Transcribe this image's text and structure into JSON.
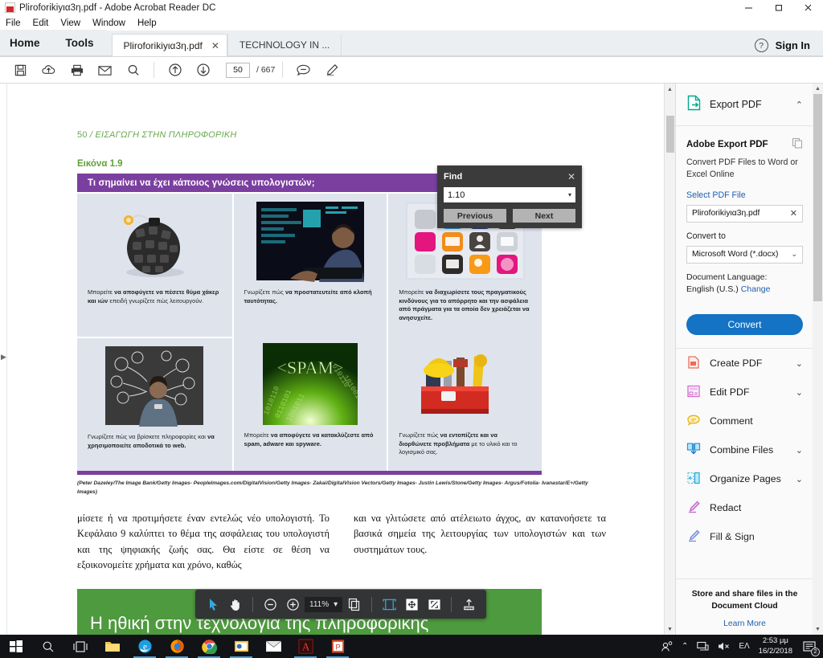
{
  "window": {
    "title": "Pliroforikiyια3η.pdf - Adobe Acrobat Reader DC",
    "minimize": "–",
    "maximize": "❐",
    "close": "✕"
  },
  "menu": [
    "File",
    "Edit",
    "View",
    "Window",
    "Help"
  ],
  "tabs": {
    "home": "Home",
    "tools": "Tools",
    "documents": [
      {
        "label": "Pliroforikiyια3η.pdf",
        "close": "✕",
        "active": true
      },
      {
        "label": "TECHNOLOGY IN ...",
        "active": false
      }
    ],
    "help_icon": "?",
    "sign_in": "Sign In"
  },
  "toolbar": {
    "icons": [
      "save-icon",
      "upload-cloud-icon",
      "print-icon",
      "email-icon",
      "search-icon",
      "previous-page-icon",
      "next-page-icon"
    ],
    "page_number": "50",
    "page_total": "/ 667",
    "comment_icon": "comment-icon",
    "highlight_icon": "highlight-icon"
  },
  "find": {
    "title": "Find",
    "close": "✕",
    "query": "1.10",
    "dropdown_caret": "▾",
    "previous": "Previous",
    "next": "Next"
  },
  "document": {
    "breadcrumb_page": "50",
    "breadcrumb_sep": "/",
    "breadcrumb_title": "ΕΙΣΑΓΩΓΗ ΣΤΗΝ ΠΛΗΡΟΦΟΡΙΚΗ",
    "figure_label": "Εικόνα 1.9",
    "banner": "Τι σημαίνει να έχει κάποιος γνώσεις υπολογιστών;",
    "cells": [
      {
        "image": "keyboard-key-bomb-photo",
        "caption_pre": "Μπορείτε ",
        "caption_bold": "να αποφύγετε να πέσετε θύμα χάκερ και ιών",
        "caption_post": " επειδή γνωρίζετε πώς λειτουργούν."
      },
      {
        "image": "hacker-at-screen-photo",
        "caption_pre": "Γνωρίζετε πώς ",
        "caption_bold": "να προστατευτείτε από κλοπή ταυτότητας.",
        "caption_post": ""
      },
      {
        "image": "security-app-icons-grid",
        "caption_pre": "Μπορείτε ",
        "caption_bold": "να διαχωρίσετε τους πραγματικούς κινδύνους για το απόρρητο και την ασφάλεια από πράγματα για τα οποία δεν χρειάζεται να ανησυχείτε.",
        "caption_post": ""
      },
      {
        "image": "woman-with-phone-chalkboard-photo",
        "caption_pre": "Γνωρίζετε πώς να βρίσκετε πληροφορίες και ",
        "caption_bold": "να χρησιμοποιείτε αποδοτικά το web.",
        "caption_post": ""
      },
      {
        "image": "spam-green-binary-photo",
        "caption_pre": "Μπορείτε ",
        "caption_bold": "να αποφύγετε να κατακλύζεστε από spam, adware και spyware.",
        "caption_post": ""
      },
      {
        "image": "red-toolbox-photo",
        "caption_pre": "Γνωρίζετε πώς ",
        "caption_bold": "να εντοπίζετε και να διορθώνετε προβλήματα",
        "caption_post": " με το υλικό και το λογισμικό σας."
      }
    ],
    "credit": "(Peter Dazeley/The Image Bank/Getty Images- PeopleImages.com/DigitalVision/Getty Images- Zakai/DigitalVision Vectors/Getty Images- Justin Lewis/Stone/Getty Images- Argus/Fotolia- Ivanastar/E+/Getty Images)",
    "body_left": "μίσετε ή να προτιμήσετε έναν εντελώς νέο υπολογιστή. Το Κεφάλαιο 9 καλύπτει το θέμα της ασφάλειας του υπολογιστή και της ψηφιακής ζωής σας. Θα είστε σε θέση να εξοικονομείτε χρήματα και χρόνο, καθώς",
    "body_right": "και να γλιτώσετε από ατέλειωτο άγχος, αν κατανοήσετε τα βασικά σημεία της λειτουργίας των υπολογιστών και των συστημάτων τους.",
    "section_heading": "Η ηθική στην τεχνολογία της πληροφορικής"
  },
  "page_toolbar": {
    "select_icon": "cursor-select-icon",
    "hand_icon": "hand-pan-icon",
    "zoom_out": "−",
    "zoom_in": "+",
    "zoom_level": "111%",
    "zoom_caret": "▾",
    "page_view_icon": "page-view-icon",
    "fit_width_icon": "fit-width-icon",
    "fit_page_icon": "fit-page-icon",
    "full_screen_icon": "full-screen-icon",
    "share_icon": "share-upload-icon"
  },
  "right_panel": {
    "header": {
      "title": "Export PDF",
      "icon": "export-pdf-icon",
      "chevron": "⌃"
    },
    "card": {
      "title": "Adobe Export PDF",
      "copy_icon": "copy-icon",
      "subtitle": "Convert PDF Files to Word or Excel Online",
      "select_file_link": "Select PDF File",
      "file_value": "Pliroforikiyια3η.pdf",
      "file_clear": "✕",
      "convert_to_label": "Convert to",
      "convert_to_value": "Microsoft Word (*.docx)",
      "convert_to_caret": "⌄",
      "language_label": "Document Language:",
      "language_value": "English (U.S.)",
      "language_change": "Change",
      "convert_button": "Convert"
    },
    "tools": [
      {
        "label": "Create PDF",
        "icon": "create-pdf-icon",
        "chevron": "⌄"
      },
      {
        "label": "Edit PDF",
        "icon": "edit-pdf-icon",
        "chevron": "⌄"
      },
      {
        "label": "Comment",
        "icon": "comment-icon",
        "chevron": ""
      },
      {
        "label": "Combine Files",
        "icon": "combine-files-icon",
        "chevron": "⌄"
      },
      {
        "label": "Organize Pages",
        "icon": "organize-pages-icon",
        "chevron": "⌄"
      },
      {
        "label": "Redact",
        "icon": "redact-icon",
        "chevron": ""
      },
      {
        "label": "Fill & Sign",
        "icon": "fill-sign-icon",
        "chevron": ""
      }
    ],
    "footer": {
      "text": "Store and share files in the Document Cloud",
      "link": "Learn More"
    }
  },
  "taskbar": {
    "start_icon": "windows-start-icon",
    "search_icon": "search-icon",
    "taskview_icon": "task-view-icon",
    "apps": [
      "file-explorer-icon",
      "internet-explorer-icon",
      "firefox-icon",
      "chrome-icon",
      "outlook-icon",
      "mail-icon",
      "acrobat-reader-icon",
      "powerpoint-icon"
    ],
    "tray": {
      "people_icon": "people-icon",
      "chevron_up": "⌃",
      "network_icon": "network-icon",
      "volume_icon": "volume-muted-icon",
      "language": "ΕΛ",
      "time": "2:53 μμ",
      "date": "16/2/2018",
      "notification_icon": "notifications-icon",
      "notification_count": "2"
    }
  },
  "colors": {
    "accent_blue": "#1473c4",
    "banner_purple": "#7b3fa0",
    "green_heading": "#4e9a3e",
    "figure_green": "#5fa03a"
  }
}
